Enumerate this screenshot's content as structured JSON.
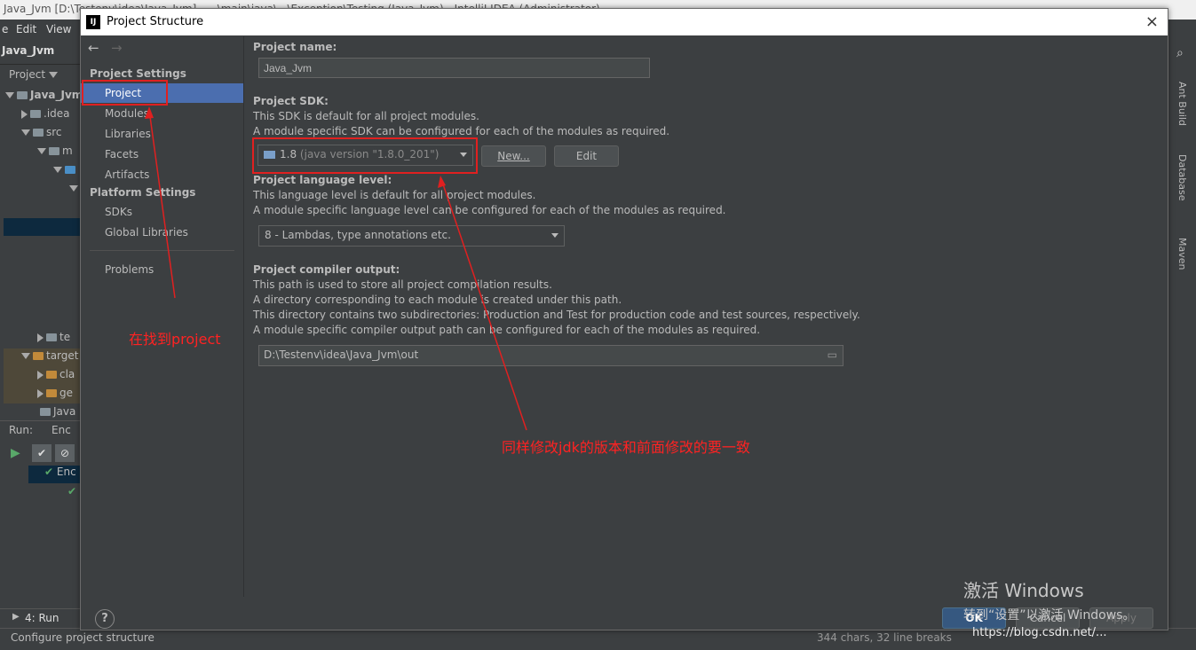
{
  "ide": {
    "title": "Java_Jvm [D:\\Testenv\\idea\\Java_Jvm] - ...\\main\\java\\...\\Exception\\Testing (Java_Jvm) - IntelliJ IDEA (Administrator)",
    "menu": [
      "e",
      "Edit",
      "View"
    ],
    "project_tab": "Java_Jvm",
    "project_view": "Project",
    "tree": [
      {
        "label": "Java_Jvm",
        "bold": true
      },
      {
        "label": ".idea"
      },
      {
        "label": "src"
      },
      {
        "label": "m"
      },
      {
        "label": ""
      },
      {
        "label": "te"
      },
      {
        "label": "target"
      },
      {
        "label": "cla"
      },
      {
        "label": "ge"
      },
      {
        "label": "Java"
      }
    ],
    "run_label": "Run:",
    "run_tab": "Enc",
    "run_item": "Enc",
    "bottom_tab": "4: Run",
    "status_text": "Configure project structure",
    "status_right": "344 chars, 32 line breaks",
    "right_tabs": [
      "Ant Build",
      "Database",
      "Maven"
    ]
  },
  "dialog": {
    "title": "Project Structure",
    "close": "×",
    "nav": {
      "project_settings_header": "Project Settings",
      "project_settings": [
        "Project",
        "Modules",
        "Libraries",
        "Facets",
        "Artifacts"
      ],
      "platform_settings_header": "Platform Settings",
      "platform_settings": [
        "SDKs",
        "Global Libraries"
      ],
      "other": [
        "Problems"
      ],
      "selected": "Project"
    },
    "project_name": {
      "label": "Project name:",
      "value": "Java_Jvm"
    },
    "project_sdk": {
      "label": "Project SDK:",
      "desc1": "This SDK is default for all project modules.",
      "desc2": "A module specific SDK can be configured for each of the modules as required.",
      "selected_version": "1.8",
      "selected_detail": "(java version \"1.8.0_201\")",
      "new_button": "New...",
      "edit_button": "Edit"
    },
    "language_level": {
      "label": "Project language level:",
      "desc1": "This language level is default for all project modules.",
      "desc2": "A module specific language level can be configured for each of the modules as required.",
      "value": "8 - Lambdas, type annotations etc."
    },
    "compiler_output": {
      "label": "Project compiler output:",
      "desc1": "This path is used to store all project compilation results.",
      "desc2": "A directory corresponding to each module is created under this path.",
      "desc3": "This directory contains two subdirectories: Production and Test for production code and test sources, respectively.",
      "desc4": "A module specific compiler output path can be configured for each of the modules as required.",
      "path": "D:\\Testenv\\idea\\Java_Jvm\\out"
    },
    "footer": {
      "help": "?",
      "ok": "OK",
      "cancel": "Cancel",
      "apply": "Apply"
    }
  },
  "annotations": {
    "find_project": "在找到project",
    "modify_jdk": "同样修改jdk的版本和前面修改的要一致",
    "color": "#ff2222"
  },
  "watermark": {
    "line1": "激活 Windows",
    "line2": "转到“设置”以激活 Windows。",
    "url": "https://blog.csdn.net/..."
  }
}
